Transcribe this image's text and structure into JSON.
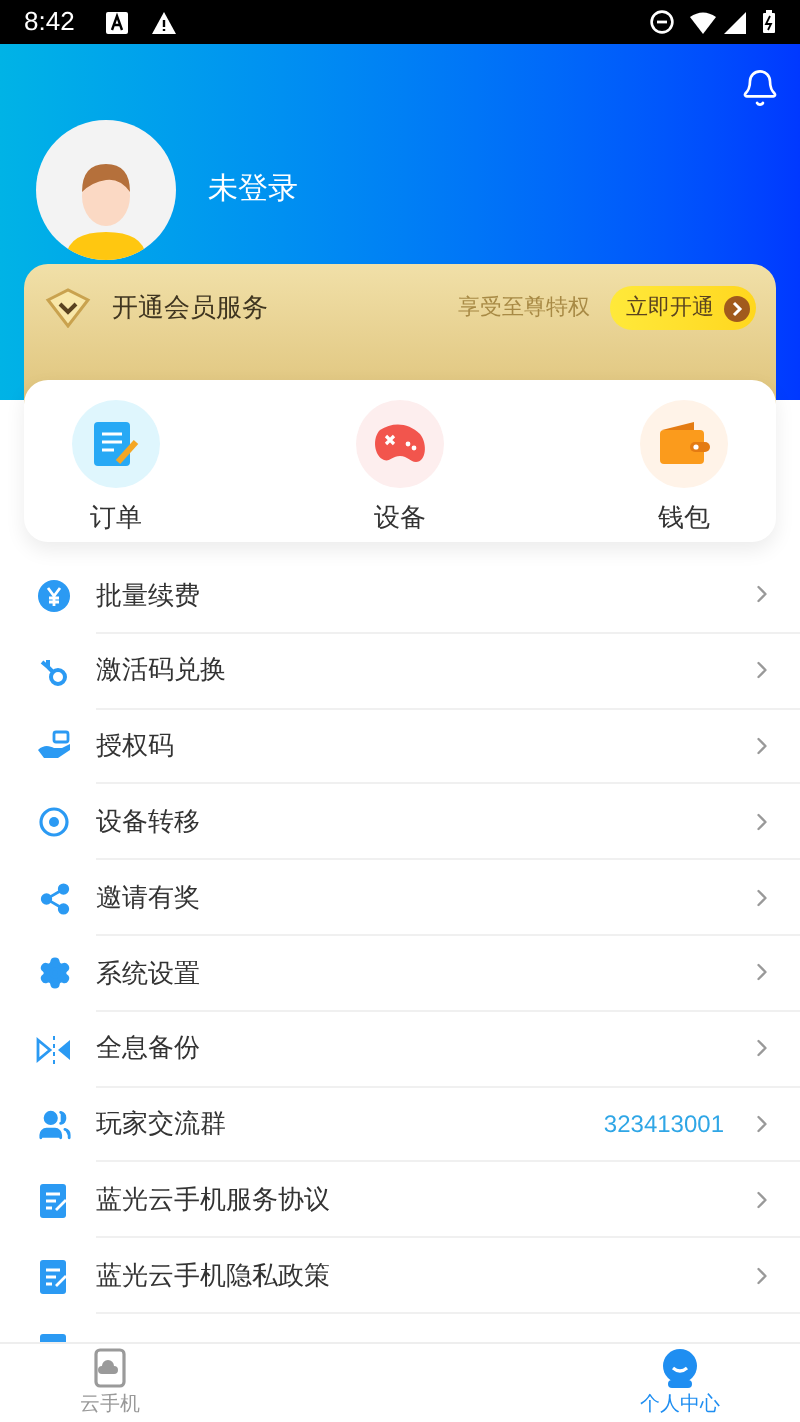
{
  "status_bar": {
    "time": "8:42"
  },
  "profile": {
    "name": "未登录"
  },
  "vip_banner": {
    "title": "开通会员服务",
    "subtitle": "享受至尊特权",
    "button": "立即开通"
  },
  "shortcuts": [
    {
      "label": "订单",
      "kind": "order"
    },
    {
      "label": "设备",
      "kind": "device"
    },
    {
      "label": "钱包",
      "kind": "wallet"
    }
  ],
  "menu": [
    {
      "label": "批量续费",
      "kind": "yuan"
    },
    {
      "label": "激活码兑换",
      "kind": "key"
    },
    {
      "label": "授权码",
      "kind": "hand"
    },
    {
      "label": "设备转移",
      "kind": "target"
    },
    {
      "label": "邀请有奖",
      "kind": "share"
    },
    {
      "label": "系统设置",
      "kind": "settings"
    },
    {
      "label": "全息备份",
      "kind": "mirror"
    },
    {
      "label": "玩家交流群",
      "kind": "group",
      "value": "323413001"
    },
    {
      "label": "蓝光云手机服务协议",
      "kind": "doc"
    },
    {
      "label": "蓝光云手机隐私政策",
      "kind": "doc"
    },
    {
      "kind": "doc"
    }
  ],
  "bottom_nav": [
    {
      "label": "云手机",
      "kind": "phone",
      "selected": false
    },
    {
      "label": "个人中心",
      "kind": "person",
      "selected": true
    }
  ]
}
